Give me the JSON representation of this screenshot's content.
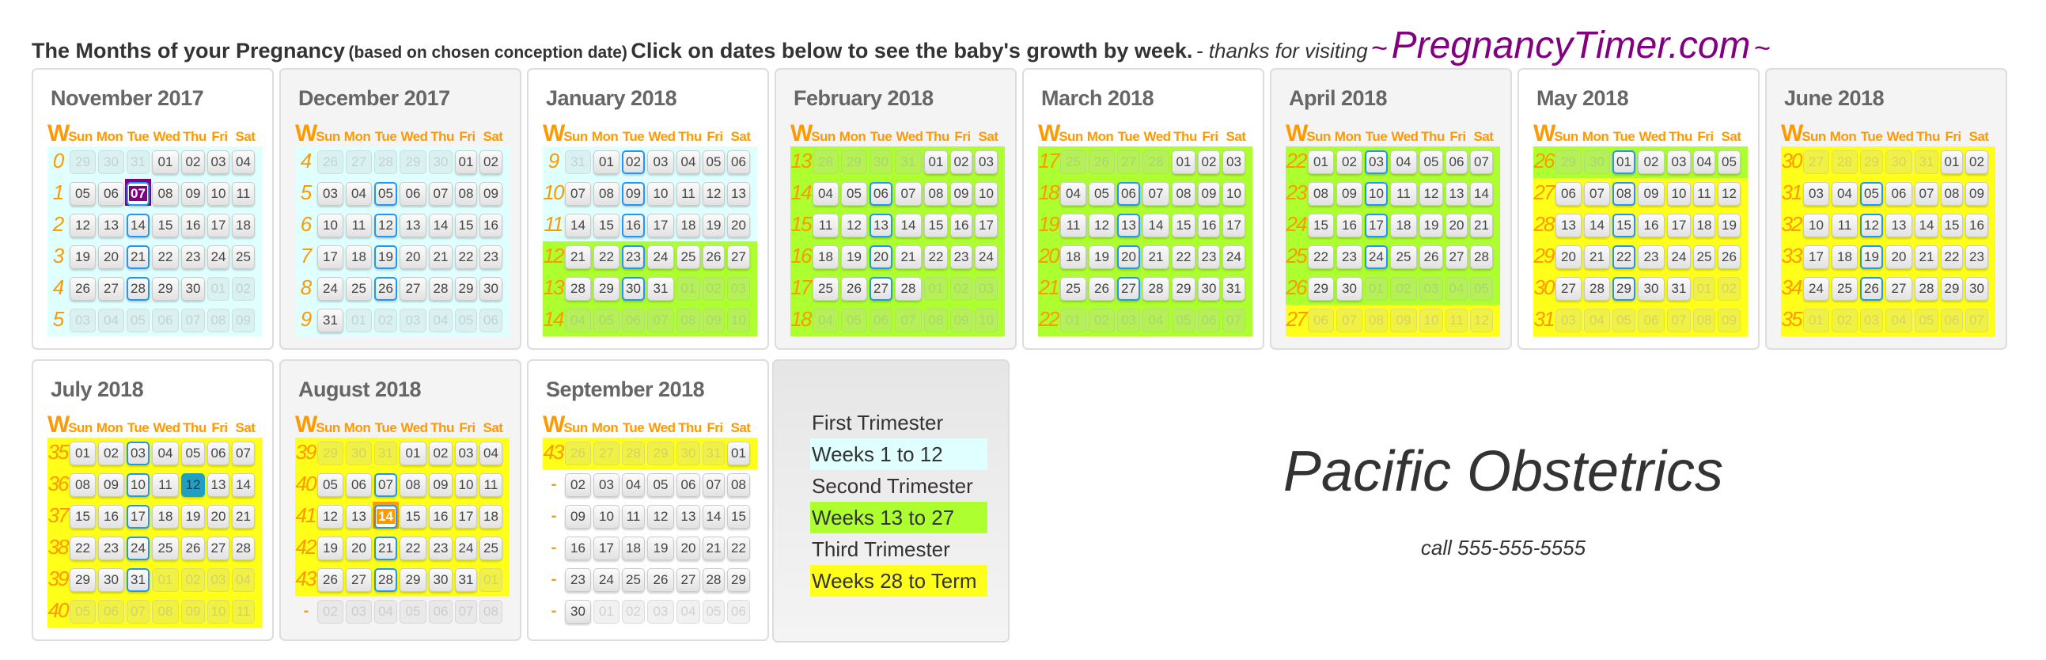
{
  "header": {
    "title": "The Months of your Pregnancy",
    "subtitle": "(based on chosen conception date)",
    "instruction": "Click on dates below to see the baby's growth by week.",
    "thanks": "- thanks for visiting",
    "tilde": "~",
    "brand": "PregnancyTimer.com"
  },
  "week_header": "W",
  "days_of_week": [
    "Sun",
    "Mon",
    "Tue",
    "Wed",
    "Thu",
    "Fri",
    "Sat"
  ],
  "colors": {
    "first_trimester": "#e0ffff",
    "second_trimester": "#adff2f",
    "third_trimester": "#ffff19",
    "conception_marker": "#800080",
    "today_marker": "#1f9fc4",
    "due_date_marker": "#ff9900",
    "tuesday_outline": "#2196f3",
    "week_number": "#ff9900",
    "brand": "#800080"
  },
  "months": [
    {
      "title": "November 2017",
      "rows": [
        {
          "week": "0",
          "tri": "first",
          "days": [
            "29*",
            "30*",
            "31*",
            "01",
            "02",
            "03",
            "04"
          ]
        },
        {
          "week": "1",
          "tri": "first",
          "days": [
            "05",
            "06",
            "07!c",
            "08",
            "09",
            "10",
            "11"
          ]
        },
        {
          "week": "2",
          "tri": "first",
          "days": [
            "12",
            "13",
            "14",
            "15",
            "16",
            "17",
            "18"
          ]
        },
        {
          "week": "3",
          "tri": "first",
          "days": [
            "19",
            "20",
            "21",
            "22",
            "23",
            "24",
            "25"
          ]
        },
        {
          "week": "4",
          "tri": "first",
          "days": [
            "26",
            "27",
            "28",
            "29",
            "30",
            "01*",
            "02*"
          ]
        },
        {
          "week": "5",
          "tri": "first",
          "days": [
            "03*",
            "04*",
            "05*",
            "06*",
            "07*",
            "08*",
            "09*"
          ]
        }
      ]
    },
    {
      "title": "December 2017",
      "rows": [
        {
          "week": "4",
          "tri": "first",
          "days": [
            "26*",
            "27*",
            "28*",
            "29*",
            "30*",
            "01",
            "02"
          ]
        },
        {
          "week": "5",
          "tri": "first",
          "days": [
            "03",
            "04",
            "05",
            "06",
            "07",
            "08",
            "09"
          ]
        },
        {
          "week": "6",
          "tri": "first",
          "days": [
            "10",
            "11",
            "12",
            "13",
            "14",
            "15",
            "16"
          ]
        },
        {
          "week": "7",
          "tri": "first",
          "days": [
            "17",
            "18",
            "19",
            "20",
            "21",
            "22",
            "23"
          ]
        },
        {
          "week": "8",
          "tri": "first",
          "days": [
            "24",
            "25",
            "26",
            "27",
            "28",
            "29",
            "30"
          ]
        },
        {
          "week": "9",
          "tri": "first",
          "days": [
            "31",
            "01*",
            "02*",
            "03*",
            "04*",
            "05*",
            "06*"
          ]
        }
      ]
    },
    {
      "title": "January 2018",
      "rows": [
        {
          "week": "9",
          "tri": "first",
          "days": [
            "31*",
            "01",
            "02",
            "03",
            "04",
            "05",
            "06"
          ]
        },
        {
          "week": "10",
          "tri": "first",
          "days": [
            "07",
            "08",
            "09",
            "10",
            "11",
            "12",
            "13"
          ]
        },
        {
          "week": "11",
          "tri": "first",
          "days": [
            "14",
            "15",
            "16",
            "17",
            "18",
            "19",
            "20"
          ]
        },
        {
          "week": "12",
          "tri": "second",
          "days": [
            "21",
            "22",
            "23",
            "24",
            "25",
            "26",
            "27"
          ]
        },
        {
          "week": "13",
          "tri": "second",
          "days": [
            "28",
            "29",
            "30",
            "31",
            "01*",
            "02*",
            "03*"
          ]
        },
        {
          "week": "14",
          "tri": "second",
          "days": [
            "04*",
            "05*",
            "06*",
            "07*",
            "08*",
            "09*",
            "10*"
          ]
        }
      ]
    },
    {
      "title": "February 2018",
      "rows": [
        {
          "week": "13",
          "tri": "second",
          "days": [
            "28*",
            "29*",
            "30*",
            "31*",
            "01",
            "02",
            "03"
          ]
        },
        {
          "week": "14",
          "tri": "second",
          "days": [
            "04",
            "05",
            "06",
            "07",
            "08",
            "09",
            "10"
          ]
        },
        {
          "week": "15",
          "tri": "second",
          "days": [
            "11",
            "12",
            "13",
            "14",
            "15",
            "16",
            "17"
          ]
        },
        {
          "week": "16",
          "tri": "second",
          "days": [
            "18",
            "19",
            "20",
            "21",
            "22",
            "23",
            "24"
          ]
        },
        {
          "week": "17",
          "tri": "second",
          "days": [
            "25",
            "26",
            "27",
            "28",
            "01*",
            "02*",
            "03*"
          ]
        },
        {
          "week": "18",
          "tri": "second",
          "days": [
            "04*",
            "05*",
            "06*",
            "07*",
            "08*",
            "09*",
            "10*"
          ]
        }
      ]
    },
    {
      "title": "March 2018",
      "rows": [
        {
          "week": "17",
          "tri": "second",
          "days": [
            "25*",
            "26*",
            "27*",
            "28*",
            "01",
            "02",
            "03"
          ]
        },
        {
          "week": "18",
          "tri": "second",
          "days": [
            "04",
            "05",
            "06",
            "07",
            "08",
            "09",
            "10"
          ]
        },
        {
          "week": "19",
          "tri": "second",
          "days": [
            "11",
            "12",
            "13",
            "14",
            "15",
            "16",
            "17"
          ]
        },
        {
          "week": "20",
          "tri": "second",
          "days": [
            "18",
            "19",
            "20",
            "21",
            "22",
            "23",
            "24"
          ]
        },
        {
          "week": "21",
          "tri": "second",
          "days": [
            "25",
            "26",
            "27",
            "28",
            "29",
            "30",
            "31"
          ]
        },
        {
          "week": "22",
          "tri": "second",
          "days": [
            "01*",
            "02*",
            "03*",
            "04*",
            "05*",
            "06*",
            "07*"
          ]
        }
      ]
    },
    {
      "title": "April 2018",
      "rows": [
        {
          "week": "22",
          "tri": "second",
          "days": [
            "01",
            "02",
            "03",
            "04",
            "05",
            "06",
            "07"
          ]
        },
        {
          "week": "23",
          "tri": "second",
          "days": [
            "08",
            "09",
            "10",
            "11",
            "12",
            "13",
            "14"
          ]
        },
        {
          "week": "24",
          "tri": "second",
          "days": [
            "15",
            "16",
            "17",
            "18",
            "19",
            "20",
            "21"
          ]
        },
        {
          "week": "25",
          "tri": "second",
          "days": [
            "22",
            "23",
            "24",
            "25",
            "26",
            "27",
            "28"
          ]
        },
        {
          "week": "26",
          "tri": "second",
          "days": [
            "29",
            "30",
            "01*",
            "02*",
            "03*",
            "04*",
            "05*"
          ]
        },
        {
          "week": "27",
          "tri": "third",
          "days": [
            "06*",
            "07*",
            "08*",
            "09*",
            "10*",
            "11*",
            "12*"
          ]
        }
      ]
    },
    {
      "title": "May 2018",
      "rows": [
        {
          "week": "26",
          "tri": "second",
          "days": [
            "29*",
            "30*",
            "01",
            "02",
            "03",
            "04",
            "05"
          ]
        },
        {
          "week": "27",
          "tri": "third",
          "days": [
            "06",
            "07",
            "08",
            "09",
            "10",
            "11",
            "12"
          ]
        },
        {
          "week": "28",
          "tri": "third",
          "days": [
            "13",
            "14",
            "15",
            "16",
            "17",
            "18",
            "19"
          ]
        },
        {
          "week": "29",
          "tri": "third",
          "days": [
            "20",
            "21",
            "22",
            "23",
            "24",
            "25",
            "26"
          ]
        },
        {
          "week": "30",
          "tri": "third",
          "days": [
            "27",
            "28",
            "29",
            "30",
            "31",
            "01*",
            "02*"
          ]
        },
        {
          "week": "31",
          "tri": "third",
          "days": [
            "03*",
            "04*",
            "05*",
            "06*",
            "07*",
            "08*",
            "09*"
          ]
        }
      ]
    },
    {
      "title": "June 2018",
      "rows": [
        {
          "week": "30",
          "tri": "third",
          "days": [
            "27*",
            "28*",
            "29*",
            "30*",
            "31*",
            "01",
            "02"
          ]
        },
        {
          "week": "31",
          "tri": "third",
          "days": [
            "03",
            "04",
            "05",
            "06",
            "07",
            "08",
            "09"
          ]
        },
        {
          "week": "32",
          "tri": "third",
          "days": [
            "10",
            "11",
            "12",
            "13",
            "14",
            "15",
            "16"
          ]
        },
        {
          "week": "33",
          "tri": "third",
          "days": [
            "17",
            "18",
            "19",
            "20",
            "21",
            "22",
            "23"
          ]
        },
        {
          "week": "34",
          "tri": "third",
          "days": [
            "24",
            "25",
            "26",
            "27",
            "28",
            "29",
            "30"
          ]
        },
        {
          "week": "35",
          "tri": "third",
          "days": [
            "01*",
            "02*",
            "03*",
            "04*",
            "05*",
            "06*",
            "07*"
          ]
        }
      ]
    },
    {
      "title": "July 2018",
      "rows": [
        {
          "week": "35",
          "tri": "third",
          "days": [
            "01",
            "02",
            "03",
            "04",
            "05",
            "06",
            "07"
          ]
        },
        {
          "week": "36",
          "tri": "third",
          "days": [
            "08",
            "09",
            "10",
            "11",
            "12!t",
            "13",
            "14"
          ]
        },
        {
          "week": "37",
          "tri": "third",
          "days": [
            "15",
            "16",
            "17",
            "18",
            "19",
            "20",
            "21"
          ]
        },
        {
          "week": "38",
          "tri": "third",
          "days": [
            "22",
            "23",
            "24",
            "25",
            "26",
            "27",
            "28"
          ]
        },
        {
          "week": "39",
          "tri": "third",
          "days": [
            "29",
            "30",
            "31",
            "01*",
            "02*",
            "03*",
            "04*"
          ]
        },
        {
          "week": "40",
          "tri": "third",
          "days": [
            "05*",
            "06*",
            "07*",
            "08*",
            "09*",
            "10*",
            "11*"
          ]
        }
      ]
    },
    {
      "title": "August 2018",
      "rows": [
        {
          "week": "39",
          "tri": "third",
          "days": [
            "29*",
            "30*",
            "31*",
            "01",
            "02",
            "03",
            "04"
          ]
        },
        {
          "week": "40",
          "tri": "third",
          "days": [
            "05",
            "06",
            "07",
            "08",
            "09",
            "10",
            "11"
          ]
        },
        {
          "week": "41",
          "tri": "third",
          "days": [
            "12",
            "13",
            "14!d",
            "15",
            "16",
            "17",
            "18"
          ]
        },
        {
          "week": "42",
          "tri": "third",
          "days": [
            "19",
            "20",
            "21",
            "22",
            "23",
            "24",
            "25"
          ]
        },
        {
          "week": "43",
          "tri": "third",
          "days": [
            "26",
            "27",
            "28",
            "29",
            "30",
            "31",
            "01*"
          ]
        },
        {
          "week": "-",
          "tri": "none",
          "days": [
            "02*",
            "03*",
            "04*",
            "05*",
            "06*",
            "07*",
            "08*"
          ]
        }
      ]
    },
    {
      "title": "September 2018",
      "no_tue_outline": true,
      "rows": [
        {
          "week": "43",
          "tri": "third",
          "days": [
            "26*",
            "27*",
            "28*",
            "29*",
            "30*",
            "31*",
            "01"
          ]
        },
        {
          "week": "-",
          "tri": "none",
          "days": [
            "02",
            "03",
            "04",
            "05",
            "06",
            "07",
            "08"
          ]
        },
        {
          "week": "-",
          "tri": "none",
          "days": [
            "09",
            "10",
            "11",
            "12",
            "13",
            "14",
            "15"
          ]
        },
        {
          "week": "-",
          "tri": "none",
          "days": [
            "16",
            "17",
            "18",
            "19",
            "20",
            "21",
            "22"
          ]
        },
        {
          "week": "-",
          "tri": "none",
          "days": [
            "23",
            "24",
            "25",
            "26",
            "27",
            "28",
            "29"
          ]
        },
        {
          "week": "-",
          "tri": "none",
          "days": [
            "30",
            "01*",
            "02*",
            "03*",
            "04*",
            "05*",
            "06*"
          ]
        }
      ]
    }
  ],
  "legend": [
    {
      "label": "First Trimester",
      "tri": "none"
    },
    {
      "label": "Weeks 1 to 12",
      "tri": "first"
    },
    {
      "label": "Second Trimester",
      "tri": "none"
    },
    {
      "label": "Weeks 13 to 27",
      "tri": "second"
    },
    {
      "label": "Third Trimester",
      "tri": "none"
    },
    {
      "label": "Weeks 28 to Term",
      "tri": "third"
    }
  ],
  "practice": {
    "name": "Pacific Obstetrics",
    "phone": "call 555-555-5555"
  }
}
